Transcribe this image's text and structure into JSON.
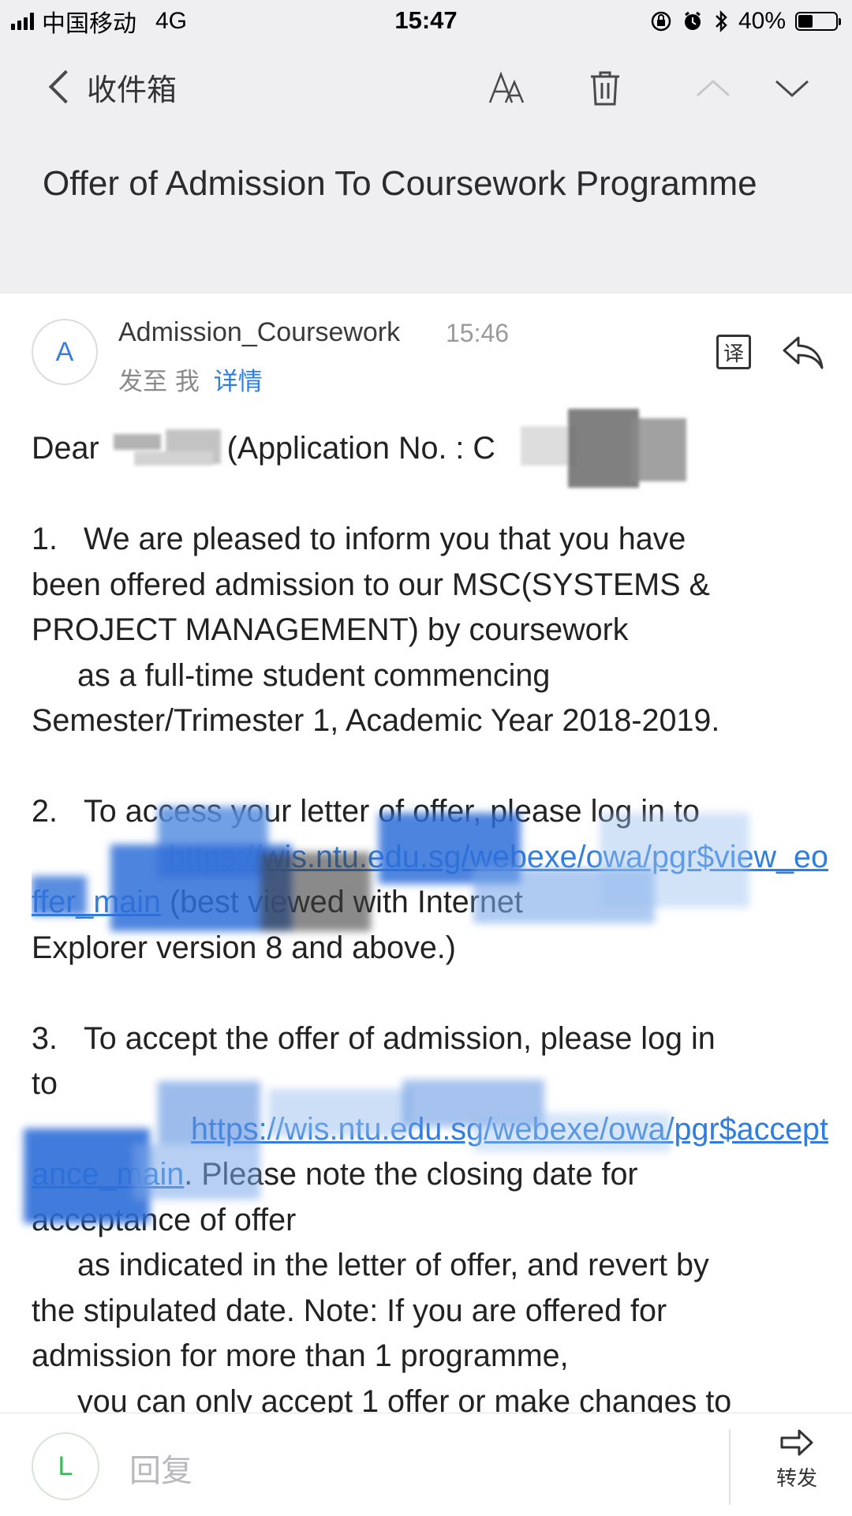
{
  "status_bar": {
    "carrier": "中国移动",
    "network": "4G",
    "time": "15:47",
    "battery_percent": "40%",
    "battery_level": 0.4
  },
  "nav": {
    "back_label": "收件箱",
    "icons": [
      "font-size-icon",
      "trash-icon",
      "chevron-up-icon",
      "chevron-down-icon"
    ]
  },
  "email": {
    "subject": "Offer of Admission To Coursework Programme",
    "avatar_letter": "A",
    "sender": "Admission_Coursework",
    "time": "15:46",
    "recipient_prefix": "发至 我",
    "details": "详情",
    "translate_glyph": "译",
    "body": {
      "greeting_prefix": "Dear",
      "greeting_suffix": "(Application No. : C",
      "p1_num": "1.",
      "p1_line1": "We are pleased to inform you that you have",
      "p1_line2": "been offered admission to our MSC(SYSTEMS &",
      "p1_line3": "PROJECT MANAGEMENT) by coursework",
      "p1_line4": "as a full-time student commencing",
      "p1_line5": "Semester/Trimester 1, Academic Year 2018-2019.",
      "p2_num": "2.",
      "p2_line1": "To access your letter of offer, please log in to",
      "p2_link1": "https://wis.ntu.edu.sg/webexe/owa/pgr$view_eo",
      "p2_link2": "ffer_main",
      "p2_after": "(best viewed with Internet",
      "p2_line4": "Explorer version 8 and above.)",
      "p3_num": "3.",
      "p3_line1": "To accept the offer of admission, please log in",
      "p3_line2": "to",
      "p3_link1": "https://wis.ntu.edu.sg/webexe/owa/pgr$accept",
      "p3_link2": "ance_main",
      "p3_after": ". Please note the closing date for",
      "p3_line5": "acceptance of offer",
      "p3_line6": "as indicated in the letter of offer, and revert by",
      "p3_line7": "the stipulated date. Note: If you are offered for",
      "p3_line8": "admission for more than 1 programme,",
      "p3_line9": "you can only accept 1 offer or make changes to"
    }
  },
  "bottom_bar": {
    "avatar_letter": "L",
    "reply_placeholder": "回复",
    "forward_label": "转发"
  },
  "colors": {
    "link_blue": "#2f7de0",
    "header_bg": "#efeff2",
    "reply_avatar_green": "#3cb85a"
  }
}
